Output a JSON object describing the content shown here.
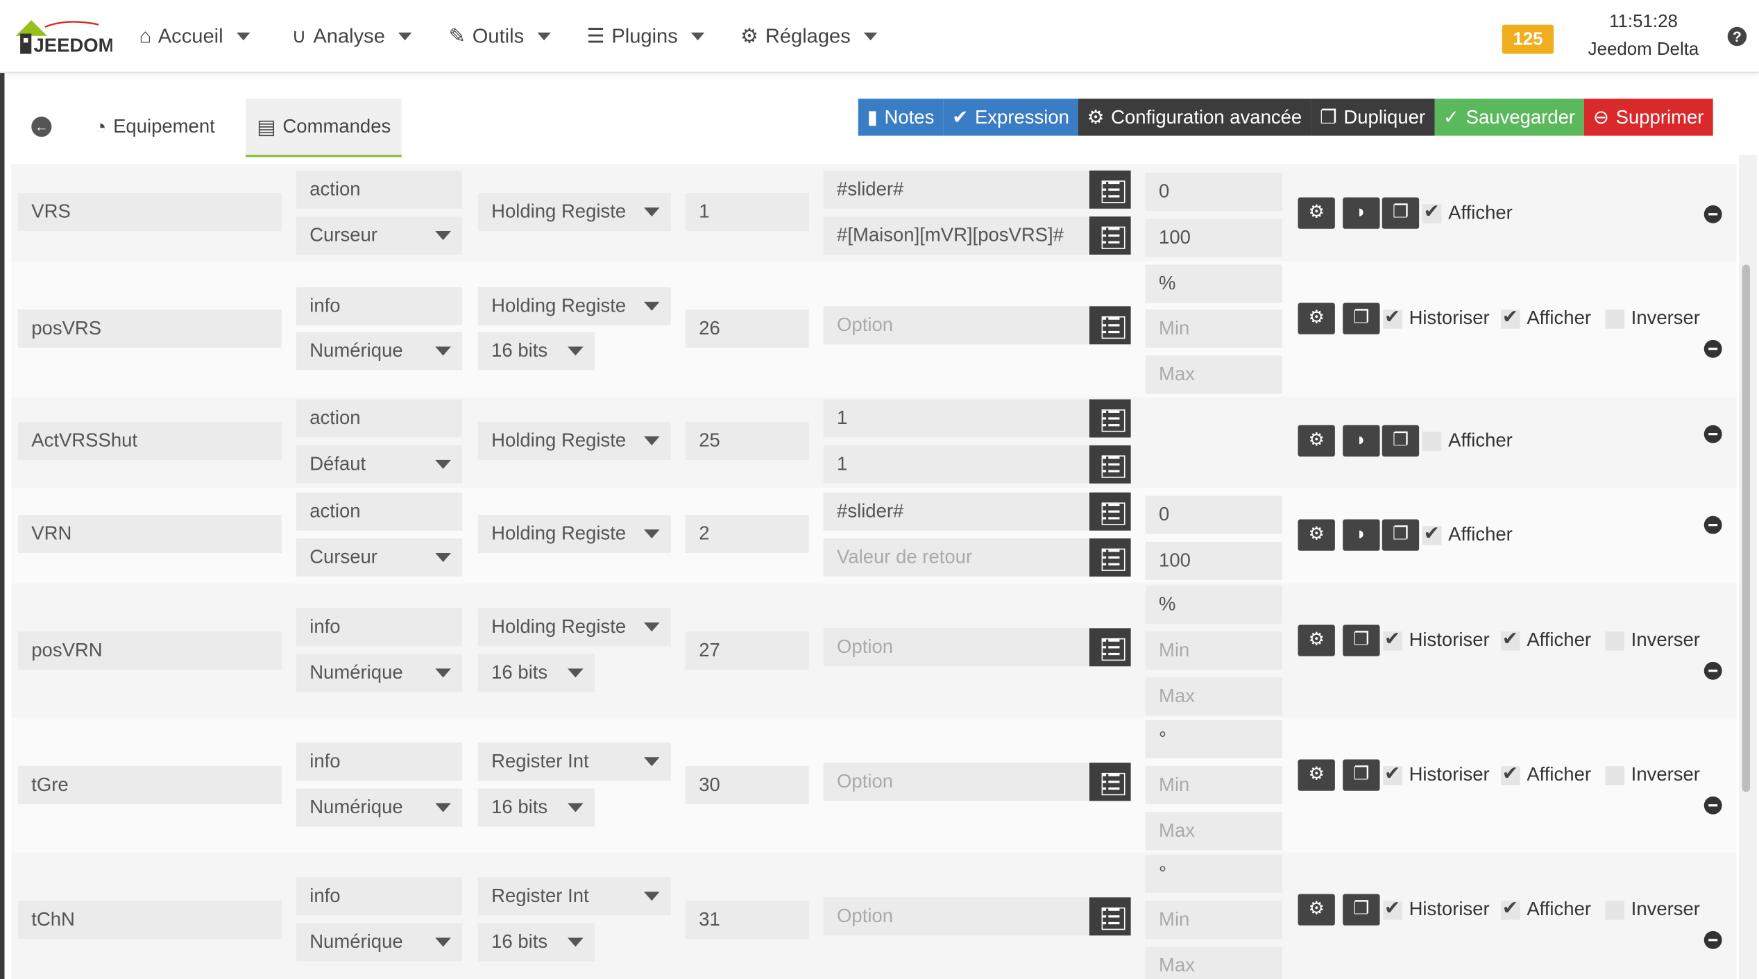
{
  "navbar": {
    "logo_text": "JEEDOM",
    "menu": [
      {
        "label": "Accueil",
        "icon": "home-icon"
      },
      {
        "label": "Analyse",
        "icon": "magnet-icon"
      },
      {
        "label": "Outils",
        "icon": "wrench-icon"
      },
      {
        "label": "Plugins",
        "icon": "tasks-icon"
      },
      {
        "label": "Réglages",
        "icon": "gear-icon"
      }
    ],
    "badge": "125",
    "time": "11:51:28",
    "site_name": "Jeedom Delta",
    "help": "?"
  },
  "tabs": {
    "equipment": "Equipement",
    "commands": "Commandes"
  },
  "actions": {
    "notes": "Notes",
    "expression": "Expression",
    "advanced": "Configuration avancée",
    "duplicate": "Dupliquer",
    "save": "Sauvegarder",
    "delete": "Supprimer"
  },
  "labels": {
    "afficher": "Afficher",
    "historiser": "Historiser",
    "inverser": "Inverser"
  },
  "commands": [
    {
      "name": "VRS",
      "type": "action",
      "subtype": "Curseur",
      "register": "Holding Registe",
      "size": "",
      "address": "1",
      "value1": "#slider#",
      "value2": "#[Maison][mVR][posVRS]#",
      "min": "0",
      "max": "100",
      "unit": "",
      "kind": "action",
      "afficher": true
    },
    {
      "name": "posVRS",
      "type": "info",
      "subtype": "Numérique",
      "register": "Holding Registe",
      "size": "16 bits",
      "address": "26",
      "option": "Option",
      "unit": "%",
      "min": "Min",
      "max": "Max",
      "kind": "info"
    },
    {
      "name": "ActVRSShut",
      "type": "action",
      "subtype": "Défaut",
      "register": "Holding Registe",
      "size": "",
      "address": "25",
      "value1": "1",
      "value2": "1",
      "kind": "action",
      "afficher": false
    },
    {
      "name": "VRN",
      "type": "action",
      "subtype": "Curseur",
      "register": "Holding Registe",
      "size": "",
      "address": "2",
      "value1": "#slider#",
      "value2": "Valeur de retour",
      "min": "0",
      "max": "100",
      "kind": "action",
      "afficher": true
    },
    {
      "name": "posVRN",
      "type": "info",
      "subtype": "Numérique",
      "register": "Holding Registe",
      "size": "16 bits",
      "address": "27",
      "option": "Option",
      "unit": "%",
      "min": "Min",
      "max": "Max",
      "kind": "info"
    },
    {
      "name": "tGre",
      "type": "info",
      "subtype": "Numérique",
      "register": "Register Int",
      "size": "16 bits",
      "address": "30",
      "option": "Option",
      "unit": "°",
      "min": "Min",
      "max": "Max",
      "kind": "info"
    },
    {
      "name": "tChN",
      "type": "info",
      "subtype": "Numérique",
      "register": "Register Int",
      "size": "16 bits",
      "address": "31",
      "option": "Option",
      "unit": "°",
      "min": "Min",
      "max": "Max",
      "kind": "info"
    }
  ]
}
